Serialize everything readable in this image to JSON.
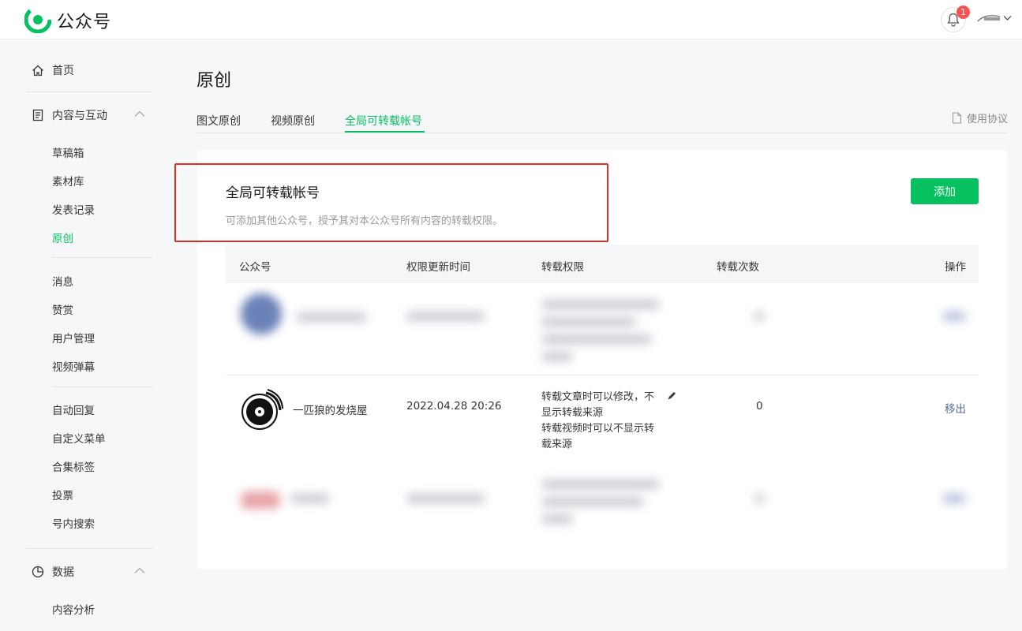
{
  "header": {
    "app_title": "公众号",
    "notification_count": "1"
  },
  "sidebar": {
    "home": "首页",
    "content_group": "内容与互动",
    "content_items": [
      "草稿箱",
      "素材库",
      "发表记录",
      "原创"
    ],
    "interaction_items": [
      "消息",
      "赞赏",
      "用户管理",
      "视频弹幕"
    ],
    "function_items": [
      "自动回复",
      "自定义菜单",
      "合集标签",
      "投票",
      "号内搜索"
    ],
    "data_group": "数据",
    "data_items": [
      "内容分析"
    ]
  },
  "main": {
    "title": "原创",
    "tabs": [
      "图文原创",
      "视频原创",
      "全局可转载帐号"
    ],
    "active_tab": "全局可转载帐号",
    "agreement": "使用协议",
    "section_title": "全局可转载帐号",
    "section_desc": "可添加其他公众号，授予其对本公众号所有内容的转载权限。",
    "add_button": "添加",
    "table": {
      "headers": [
        "公众号",
        "权限更新时间",
        "转载权限",
        "转载次数",
        "操作"
      ],
      "row": {
        "account": "一匹狼的发烧屋",
        "updated": "2022.04.28 20:26",
        "permission_1": "转载文章时可以修改，不显示转载来源",
        "permission_2": "转载视频时可以不显示转载来源",
        "count": "0",
        "action": "移出"
      }
    }
  },
  "colors": {
    "accent": "#07c160",
    "highlight_border": "#d93025",
    "link": "#576b95",
    "badge": "#fa5151"
  }
}
